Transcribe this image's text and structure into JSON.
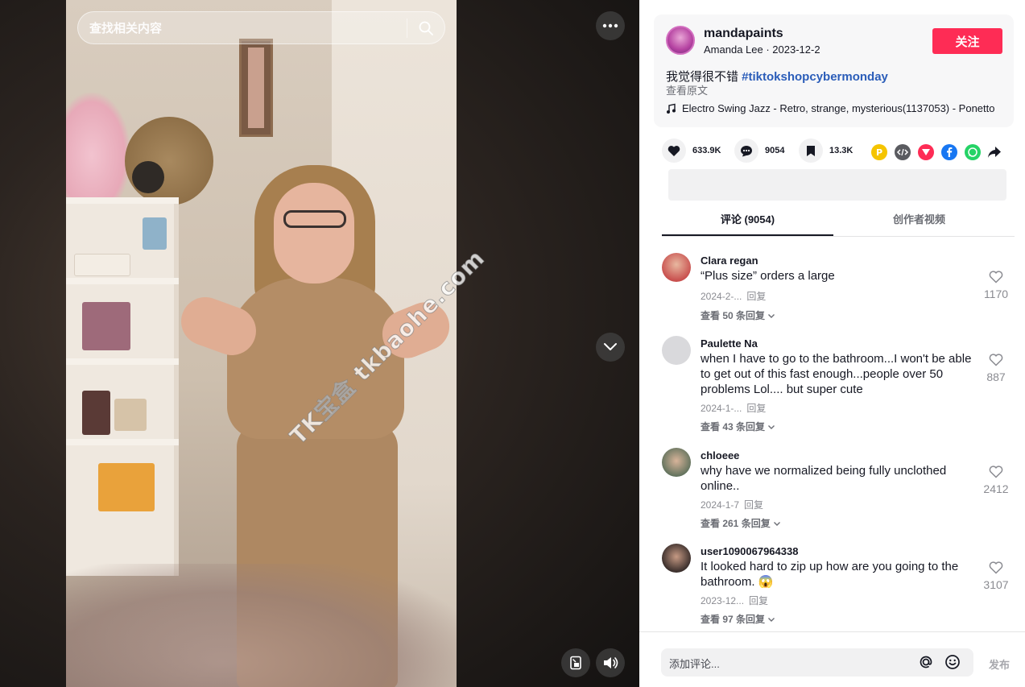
{
  "video": {
    "search_placeholder": "查找相关内容",
    "watermark": "TK宝盒 tkbaohe.com"
  },
  "post": {
    "username": "mandapaints",
    "nickname": "Amanda Lee",
    "separator": " · ",
    "date": "2023-12-2",
    "follow_label": "关注",
    "description": "我觉得很不错 ",
    "hashtag": "#tiktokshopcybermonday",
    "see_original": "查看原文",
    "music": "Electro Swing Jazz - Retro, strange, mysterious(1137053) - Ponetto"
  },
  "actions": {
    "likes": "633.9K",
    "comments": "9054",
    "saves": "13.3K",
    "share_colors": [
      "#f5c400",
      "#5a5b60",
      "#fe2c55",
      "#1877f2",
      "#25d366"
    ]
  },
  "tabs": {
    "comments_label": "评论 (9054)",
    "creator_videos_label": "创作者视频"
  },
  "comments": [
    {
      "user": "Clara regan",
      "text": "“Plus size” orders a large",
      "date": "2024-2-...",
      "reply": "回复",
      "more": "查看 50 条回复",
      "likes": "1170",
      "avatar_color": "#c9514f"
    },
    {
      "user": "Paulette Na",
      "text": "when I have to go to the bathroom...I won't be able to get out of this fast enough...people over 50 problems Lol.... but super cute",
      "date": "2024-1-...",
      "reply": "回复",
      "more": "查看 43 条回复",
      "likes": "887",
      "avatar_color": "#d9d9dc"
    },
    {
      "user": "chloeee",
      "text": "why have we normalized being fully unclothed online..",
      "date": "2024-1-7",
      "reply": "回复",
      "more": "查看 261 条回复",
      "likes": "2412",
      "avatar_color": "#5c6f5a"
    },
    {
      "user": "user1090067964338",
      "text": "It looked hard to zip up how are you going to the bathroom. 😱",
      "date": "2023-12...",
      "reply": "回复",
      "more": "查看 97 条回复",
      "likes": "3107",
      "avatar_color": "#3b2f2c"
    }
  ],
  "footer": {
    "comment_placeholder": "添加评论...",
    "post_label": "发布"
  }
}
